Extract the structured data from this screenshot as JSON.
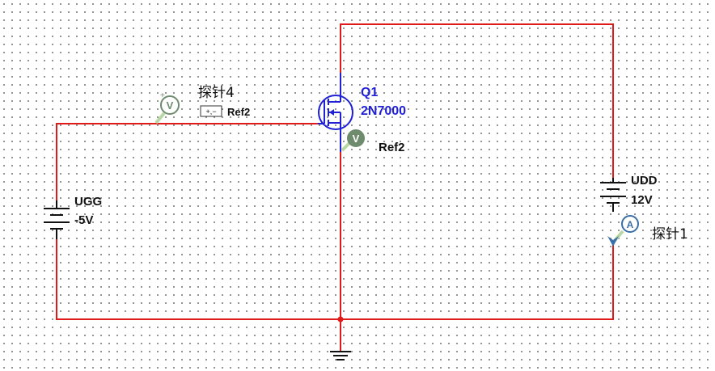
{
  "components": {
    "ugg": {
      "name": "UGG",
      "value": "-5V"
    },
    "udd": {
      "name": "UDD",
      "value": "12V"
    },
    "q1": {
      "name": "Q1",
      "model": "2N7000"
    },
    "probe4": {
      "name": "探针4",
      "ref": "Ref2",
      "meter": "V",
      "ref_symbol": "+,−"
    },
    "probe_ref2": {
      "name": "Ref2",
      "meter": "V"
    },
    "probe1": {
      "name": "探针1",
      "meter": "A"
    }
  },
  "colors": {
    "wire": "#e01919",
    "component": "#111111",
    "transistor": "#1f1fd6",
    "probe_voltage": "#6e8b6e",
    "probe_ammeter": "#3a6fa8",
    "junction": "#e01919"
  },
  "icons": [
    "voltage-probe-icon",
    "ammeter-probe-icon",
    "ground-icon",
    "battery-icon",
    "mosfet-icon"
  ]
}
